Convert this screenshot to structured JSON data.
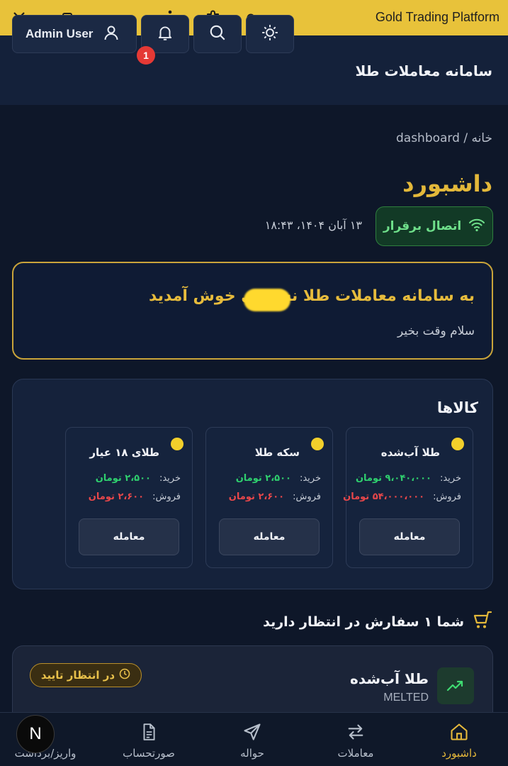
{
  "window": {
    "title": "Gold Trading Platform"
  },
  "header": {
    "app_title": "سامانه معاملات طلا",
    "user_label": "Admin User",
    "notification_count": "1"
  },
  "breadcrumb": "خانه / dashboard",
  "page": {
    "title": "داشبورد"
  },
  "connection": {
    "status": "اتصال برقرار",
    "datetime": "۱۳ آبان ۱۴۰۴، ۱۸:۴۳"
  },
  "welcome": {
    "title": "به سامانه معاملات طلا نسخه‌ی خوش آمدید",
    "subtitle": "سلام وقت بخیر"
  },
  "goods": {
    "title": "کالاها",
    "buy_label": "خرید:",
    "sell_label": "فروش:",
    "trade_label": "معامله",
    "items": [
      {
        "name": "طلا آب‌شده",
        "buy": "۹،۰۴۰،۰۰۰ تومان",
        "sell": "۵۴،۰۰۰،۰۰۰ تومان"
      },
      {
        "name": "سکه طلا",
        "buy": "۲،۵۰۰ تومان",
        "sell": "۲،۶۰۰ تومان"
      },
      {
        "name": "طلای ۱۸ عیار",
        "buy": "۲،۵۰۰ تومان",
        "sell": "۲،۶۰۰ تومان"
      }
    ]
  },
  "pending": {
    "text": "شما ۱ سفارش در انتظار دارید"
  },
  "order": {
    "name": "طلا آب‌شده",
    "code": "MELTED",
    "status": "در انتظار تایید"
  },
  "nav": {
    "items": [
      {
        "label": "داشبورد",
        "active": true
      },
      {
        "label": "معاملات"
      },
      {
        "label": "حواله"
      },
      {
        "label": "صورتحساب"
      },
      {
        "label": "واریز/برداشت"
      }
    ]
  },
  "dev_badge": "N",
  "colors": {
    "accent": "#e6b93b",
    "buy": "#2fcf6e",
    "sell": "#e8474a",
    "titlebar": "#e8c23a"
  }
}
